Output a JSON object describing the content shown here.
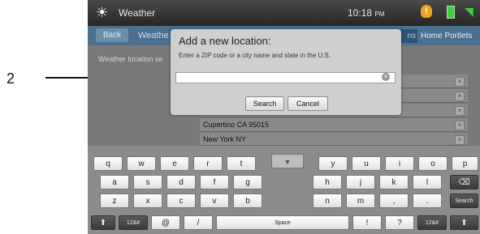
{
  "callout": {
    "number": "2"
  },
  "statusbar": {
    "app_title": "Weather",
    "time": "10:18",
    "ampm": "PM",
    "alert_glyph": "!"
  },
  "navbar": {
    "back_label": "Back",
    "weather_label": "Weathe",
    "tab_fragment": "ns",
    "home_portlets": "Home Portlets"
  },
  "content": {
    "settings_label": "Weather location se",
    "locations": [
      "",
      "",
      "",
      "Cupertino CA 95015",
      "New York NY"
    ],
    "delete_glyph": "×"
  },
  "dialog": {
    "title": "Add a new location:",
    "subtitle": "Enter a ZIP code or a city name and state in the U.S.",
    "input_value": "",
    "clear_glyph": "×",
    "search_label": "Search",
    "cancel_label": "Cancel"
  },
  "keyboard": {
    "row1": [
      "q",
      "w",
      "e",
      "r",
      "t",
      "",
      "y",
      "u",
      "i",
      "o",
      "p"
    ],
    "row2": [
      "a",
      "s",
      "d",
      "f",
      "g",
      "h",
      "j",
      "k",
      "l"
    ],
    "row3": [
      "z",
      "x",
      "c",
      "v",
      "b",
      "n",
      "m",
      ",",
      "."
    ],
    "row4": {
      "shift": "⬆",
      "numsym": "12&#",
      "at": "@",
      "slash": "/",
      "space": "Space",
      "excl": "!",
      "question": "?",
      "numsym2": "12&#",
      "shift2": "⬆"
    },
    "hide_glyph": "▼",
    "delete_glyph": "⌫",
    "search_key": "Search"
  }
}
